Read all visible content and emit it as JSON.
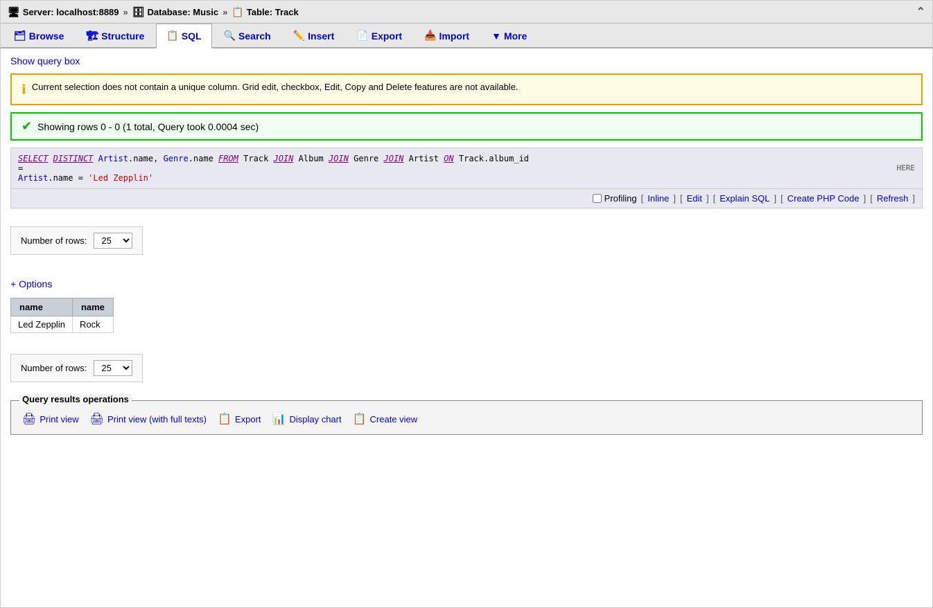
{
  "header": {
    "server_label": "Server: localhost:8889",
    "db_label": "Database: Music",
    "table_label": "Table: Track",
    "sep": "»"
  },
  "nav": {
    "tabs": [
      {
        "id": "browse",
        "label": "Browse",
        "icon": "🗂"
      },
      {
        "id": "structure",
        "label": "Structure",
        "icon": "🏗"
      },
      {
        "id": "sql",
        "label": "SQL",
        "icon": "📋",
        "active": true
      },
      {
        "id": "search",
        "label": "Search",
        "icon": "🔍"
      },
      {
        "id": "insert",
        "label": "Insert",
        "icon": "✏️"
      },
      {
        "id": "export",
        "label": "Export",
        "icon": "📄"
      },
      {
        "id": "import",
        "label": "Import",
        "icon": "📥"
      },
      {
        "id": "more",
        "label": "More",
        "icon": "▼"
      }
    ]
  },
  "show_query_box": "Show query box",
  "warning": {
    "icon": "ℹ",
    "text": "Current selection does not contain a unique column. Grid edit, checkbox, Edit, Copy and Delete features are not available."
  },
  "success": {
    "icon": "✔",
    "text": "Showing rows 0 - 0 (1 total, Query took 0.0004 sec)"
  },
  "sql_display": {
    "line1": "SELECT DISTINCT Artist.name, Genre.name FROM Track JOIN Album JOIN Genre JOIN Artist ON Track.album_id",
    "line2": "=",
    "line3": "Artist.name = 'Led Zepplin'"
  },
  "toolbar": {
    "profiling_label": "Profiling",
    "inline_label": "Inline",
    "edit_label": "Edit",
    "explain_label": "Explain SQL",
    "php_label": "Create PHP Code",
    "refresh_label": "Refresh"
  },
  "rows_top": {
    "label": "Number of rows:",
    "value": "25"
  },
  "options_label": "+ Options",
  "table": {
    "columns": [
      "name",
      "name"
    ],
    "rows": [
      [
        "Led Zepplin",
        "Rock"
      ]
    ]
  },
  "rows_bottom": {
    "label": "Number of rows:",
    "value": "25"
  },
  "operations": {
    "title": "Query results operations",
    "items": [
      {
        "id": "print-view",
        "icon": "🖨",
        "label": "Print view"
      },
      {
        "id": "print-view-full",
        "icon": "🖨",
        "label": "Print view (with full texts)"
      },
      {
        "id": "export",
        "icon": "📋",
        "label": "Export"
      },
      {
        "id": "display-chart",
        "icon": "📊",
        "label": "Display chart"
      },
      {
        "id": "create-view",
        "icon": "📋",
        "label": "Create view"
      }
    ]
  }
}
